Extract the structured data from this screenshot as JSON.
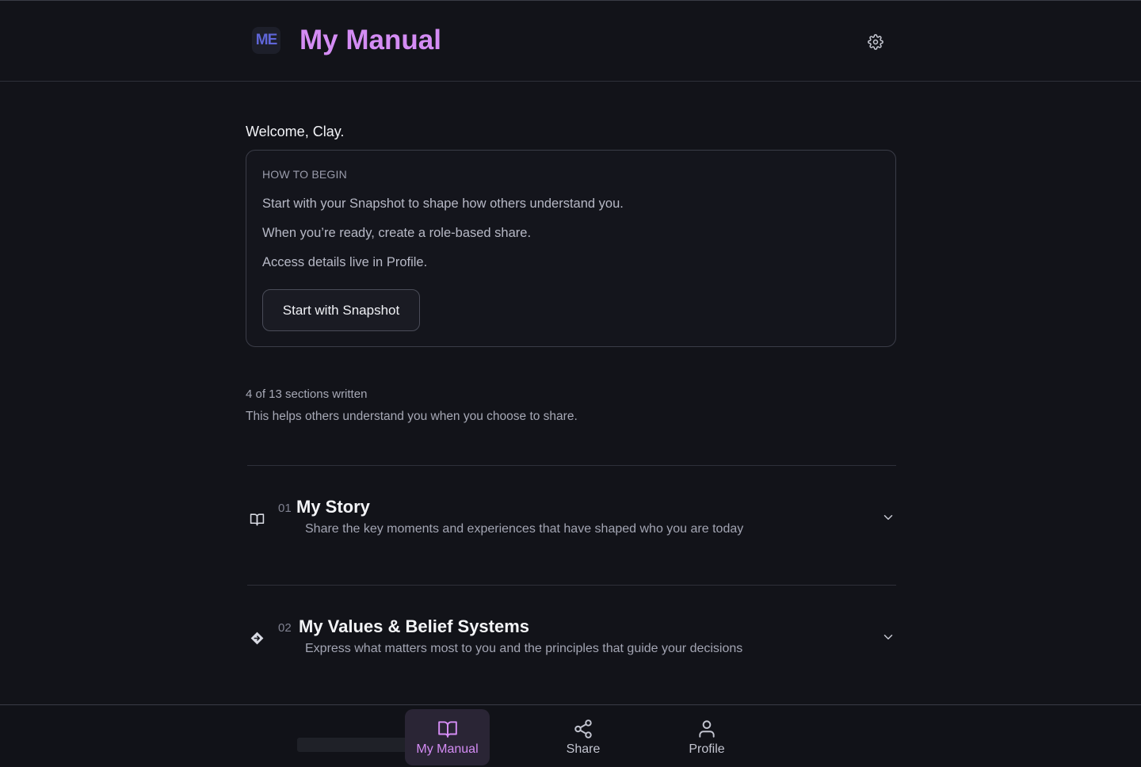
{
  "header": {
    "logo_text": "ME",
    "title": "My Manual",
    "settings_icon": "gear-icon"
  },
  "welcome": "Welcome, Clay.",
  "how_to_begin": {
    "label": "HOW TO BEGIN",
    "lines": [
      "Start with your Snapshot to shape how others understand you.",
      "When you’re ready, create a role-based share.",
      "Access details live in Profile."
    ],
    "button_label": "Start with Snapshot"
  },
  "progress": {
    "count_text": "4 of 13 sections written",
    "written": 4,
    "total": 13,
    "note": "This helps others understand you when you choose to share."
  },
  "sections": [
    {
      "number": "01",
      "title": "My Story",
      "description": "Share the key moments and experiences that have shaped who you are today",
      "icon": "open-book-icon"
    },
    {
      "number": "02",
      "title": "My Values & Belief Systems",
      "description": "Express what matters most to you and the principles that guide your decisions",
      "icon": "compass-diamond-icon"
    }
  ],
  "bottom_nav": {
    "items": [
      {
        "label": "My Manual",
        "icon": "book-icon",
        "active": true
      },
      {
        "label": "Share",
        "icon": "share-icon",
        "active": false
      },
      {
        "label": "Profile",
        "icon": "user-icon",
        "active": false
      }
    ]
  },
  "colors": {
    "background": "#121319",
    "accent": "#d48cf4",
    "logo": "#5f66d8",
    "active_nav_bg": "#2a2535"
  }
}
